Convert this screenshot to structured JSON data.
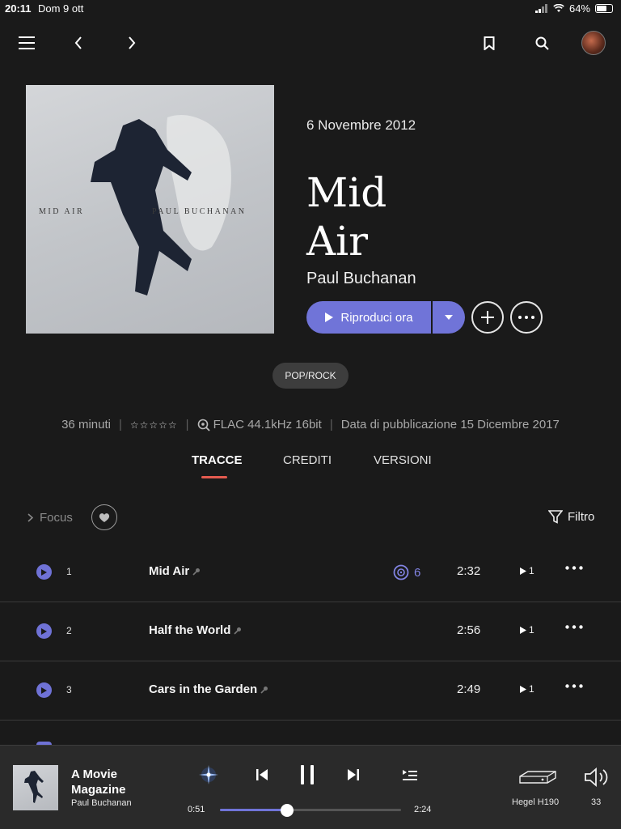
{
  "status_bar": {
    "time": "20:11",
    "date": "Dom 9 ott",
    "battery": "64%",
    "battery_level": 0.64
  },
  "album": {
    "cover_left_text": "MID AIR",
    "cover_right_text": "PAUL BUCHANAN",
    "release_date": "6 Novembre 2012",
    "title_line1": "Mid",
    "title_line2": "Air",
    "artist": "Paul Buchanan",
    "play_label": "Riproduci ora",
    "genre": "POP/ROCK"
  },
  "meta": {
    "duration": "36 minuti",
    "stars": "☆☆☆☆☆",
    "format": "FLAC 44.1kHz 16bit",
    "publication": "Data di pubblicazione 15 Dicembre 2017"
  },
  "tabs": [
    {
      "label": "TRACCE",
      "active": true
    },
    {
      "label": "CREDITI",
      "active": false
    },
    {
      "label": "VERSIONI",
      "active": false
    }
  ],
  "toolbar": {
    "focus_label": "Focus",
    "filter_label": "Filtro"
  },
  "tracks": [
    {
      "num": "1",
      "title": "Mid Air",
      "plays": "6",
      "duration": "2:32",
      "disc": "1"
    },
    {
      "num": "2",
      "title": "Half the World",
      "plays": "",
      "duration": "2:56",
      "disc": "1"
    },
    {
      "num": "3",
      "title": "Cars in the Garden",
      "plays": "",
      "duration": "2:49",
      "disc": "1"
    }
  ],
  "player": {
    "title": "A Movie Magazine",
    "artist": "Paul Buchanan",
    "elapsed": "0:51",
    "remaining": "2:24",
    "progress": 0.37,
    "device": "Hegel H190",
    "volume": "33"
  },
  "colors": {
    "accent": "#7074d8",
    "tab_underline": "#e45b4f",
    "background": "#1a1a1a",
    "player_bg": "#2a2a2a"
  }
}
